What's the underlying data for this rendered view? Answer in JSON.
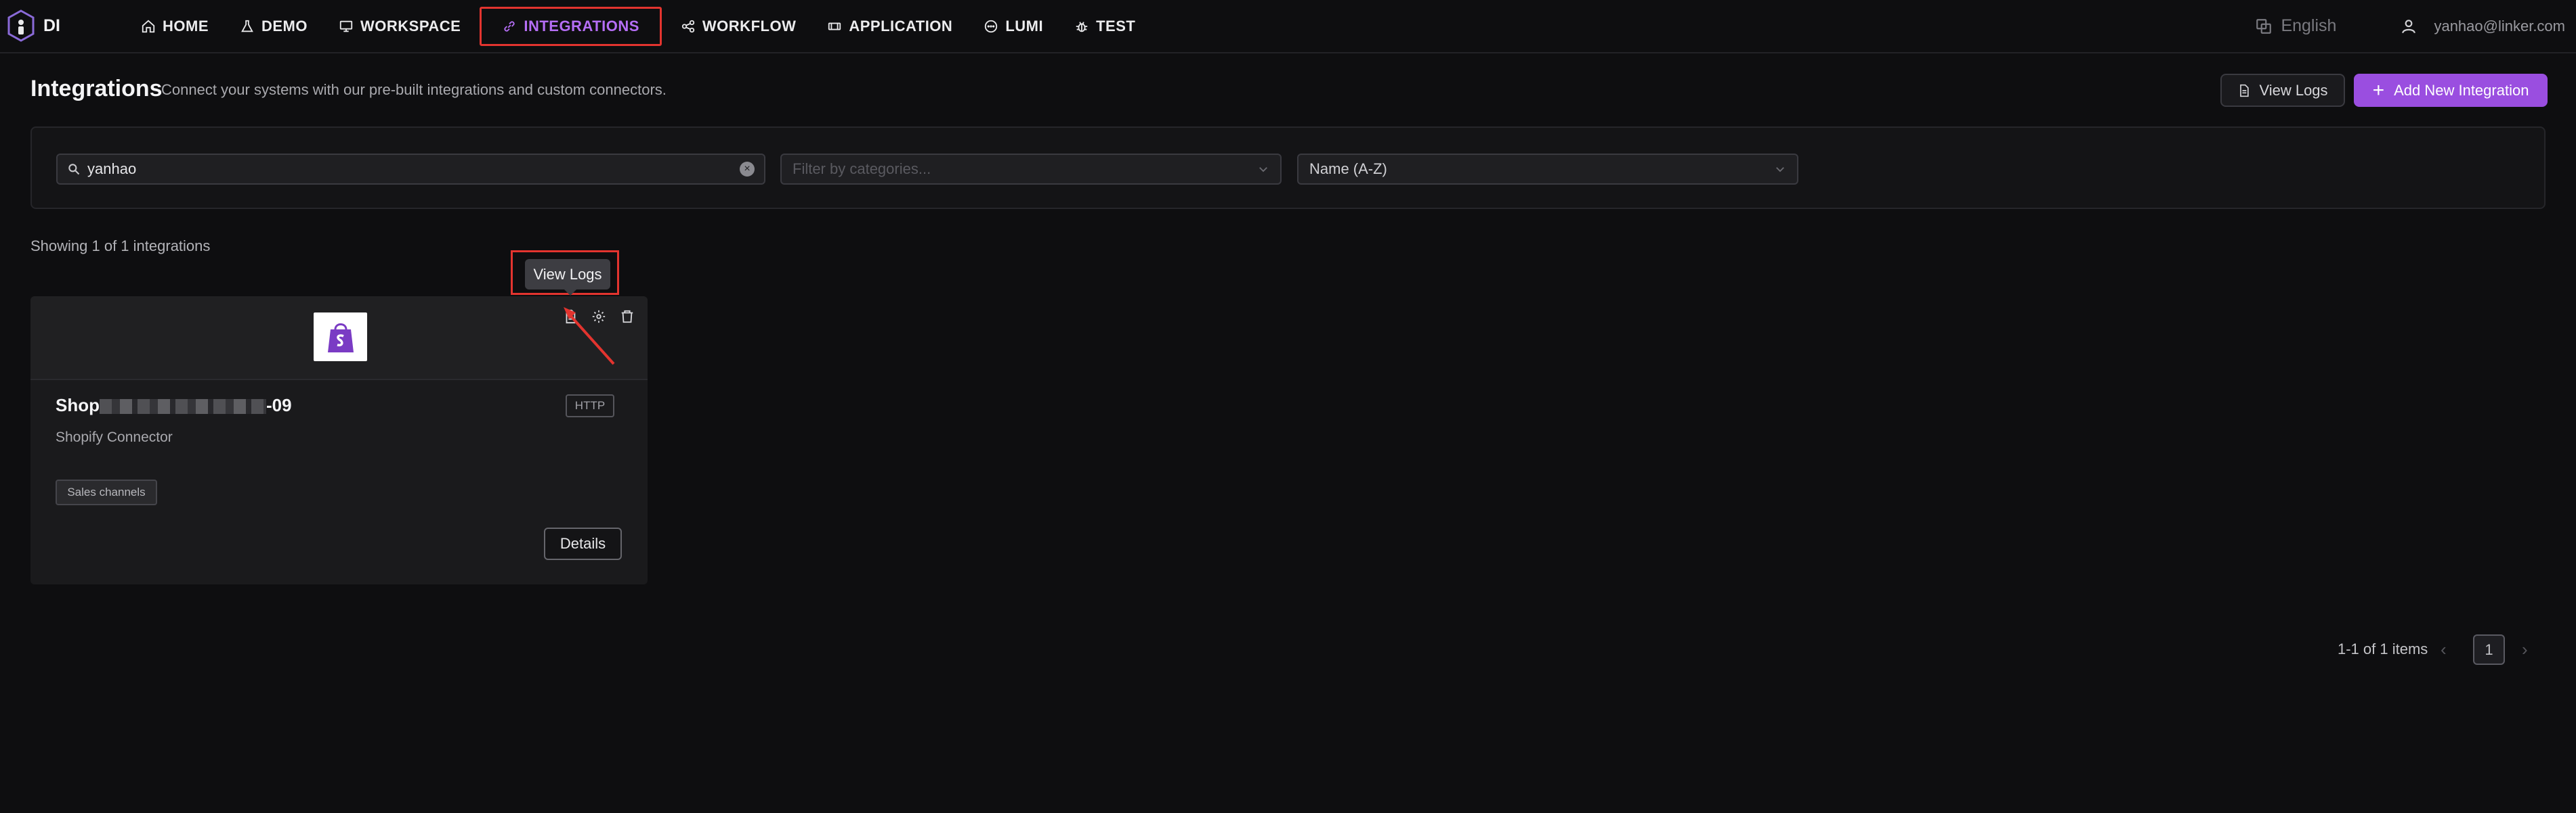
{
  "brand": {
    "name": "DI"
  },
  "nav": {
    "items": [
      {
        "label": "HOME",
        "icon": "home-icon"
      },
      {
        "label": "DEMO",
        "icon": "flask-icon"
      },
      {
        "label": "WORKSPACE",
        "icon": "monitor-icon"
      },
      {
        "label": "INTEGRATIONS",
        "icon": "link-icon",
        "active": true
      },
      {
        "label": "WORKFLOW",
        "icon": "share-icon"
      },
      {
        "label": "APPLICATION",
        "icon": "app-icon"
      },
      {
        "label": "LUMI",
        "icon": "chat-icon"
      },
      {
        "label": "TEST",
        "icon": "bug-icon"
      }
    ],
    "active_color": "#b56ef5"
  },
  "top_right": {
    "language": "English",
    "user_email": "yanhao@linker.com"
  },
  "header": {
    "title": "Integrations",
    "subtitle": "Connect your systems with our pre-built integrations and custom connectors.",
    "view_logs_label": "View Logs",
    "add_label": "Add New Integration",
    "accent_color": "#9a4ee0"
  },
  "filters": {
    "search_value": "yanhao",
    "category_placeholder": "Filter by categories...",
    "sort_value": "Name (A-Z)"
  },
  "results": {
    "showing_text": "Showing 1 of 1 integrations"
  },
  "tooltip": {
    "text": "View Logs"
  },
  "card": {
    "name_prefix": "Shop",
    "name_suffix": "-09",
    "protocol": "HTTP",
    "type": "Shopify Connector",
    "tag": "Sales channels",
    "details_label": "Details"
  },
  "pagination": {
    "range_text": "1-1 of 1 items",
    "current_page": "1",
    "prev": "‹",
    "next": "›"
  }
}
